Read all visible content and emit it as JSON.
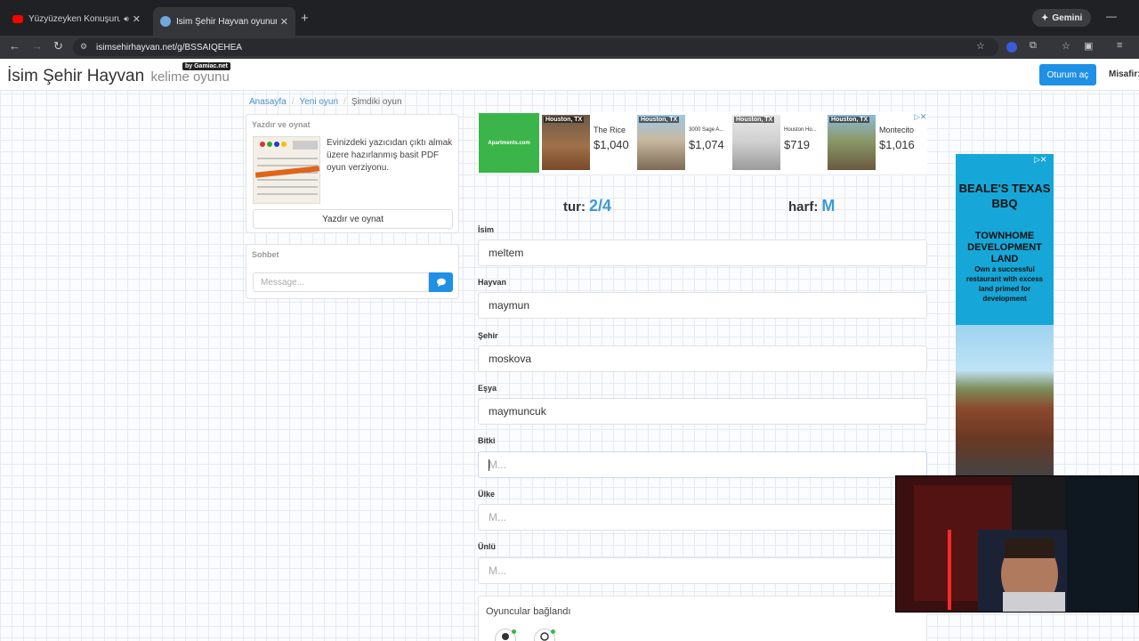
{
  "browser": {
    "tabs": [
      {
        "title": "Yüzyüzeyken Konuşuruz - D",
        "active": false
      },
      {
        "title": "İsim Şehir Hayvan oyununa katıl",
        "active": true
      }
    ],
    "gemini_label": "Gemini",
    "url": "isimsehirhayvan.net/g/BSSAIQEHEA"
  },
  "site": {
    "brand": "İsim Şehir Hayvan",
    "brand_sub": "kelime oyunu",
    "byline": "by Gamiac.net",
    "login_label": "Oturum aç",
    "guest_label": "Misafir:"
  },
  "breadcrumb": [
    "Anasayfa",
    "Yeni oyun",
    "Şimdiki oyun"
  ],
  "print_panel": {
    "title": "Yazdır ve oynat",
    "description": "Evinizdeki yazıcıdan çıktı almak üzere hazırlanmış basit PDF oyun verziyonu.",
    "button": "Yazdır ve oynat"
  },
  "chat": {
    "title": "Sohbet",
    "placeholder": "Message..."
  },
  "ad_top": {
    "logo": "Apartments.com",
    "listings": [
      {
        "city": "Houston, TX",
        "name": "The Rice",
        "price": "$1,040"
      },
      {
        "city": "Houston, TX",
        "name": "3000 Sage A...",
        "price": "$1,074"
      },
      {
        "city": "Houston, TX",
        "name": "Houston Ho...",
        "price": "$719"
      },
      {
        "city": "Houston, TX",
        "name": "Montecito",
        "price": "$1,016"
      }
    ]
  },
  "game": {
    "round_label": "tur:",
    "round_value": "2/4",
    "letter_label": "harf:",
    "letter_value": "M",
    "fields": [
      {
        "label": "İsim",
        "value": "meltem",
        "placeholder": ""
      },
      {
        "label": "Hayvan",
        "value": "maymun",
        "placeholder": ""
      },
      {
        "label": "Şehir",
        "value": "moskova",
        "placeholder": ""
      },
      {
        "label": "Eşya",
        "value": "maymuncuk",
        "placeholder": ""
      },
      {
        "label": "Bitki",
        "value": "",
        "placeholder": "M..."
      },
      {
        "label": "Ülke",
        "value": "",
        "placeholder": "M..."
      },
      {
        "label": "Ünlü",
        "value": "",
        "placeholder": "M..."
      }
    ],
    "players_title": "Oyuncular bağlandı"
  },
  "ad_side": {
    "headline": "BEALE'S TEXAS BBQ",
    "subhead": "TOWNHOME DEVELOPMENT LAND",
    "body": "Own a successful restaurant with excess land primed for development"
  },
  "colors": {
    "accent": "#1e90e6",
    "round_value": "#3a9ad9",
    "ad_green": "#3bb54a",
    "ad_blue": "#16a7d8"
  }
}
